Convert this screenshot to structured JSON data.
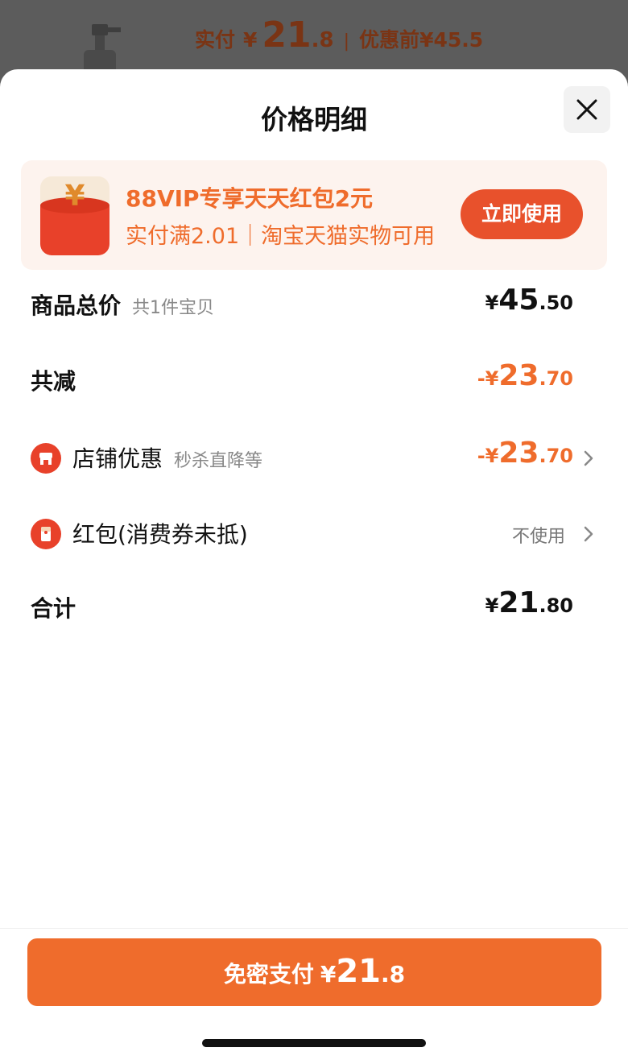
{
  "background": {
    "paid_label": "实付",
    "currency": "¥",
    "paid_int": "21",
    "paid_dec": ".8",
    "separator": "|",
    "original_label": "优惠前",
    "original_price": "¥45.5"
  },
  "sheet": {
    "title": "价格明细"
  },
  "promo": {
    "icon_char": "¥",
    "title": "88VIP专享天天红包2元",
    "subtitle": "实付满2.01｜淘宝天猫实物可用",
    "button_label": "立即使用"
  },
  "rows": {
    "total": {
      "label": "商品总价",
      "hint": "共1件宝贝",
      "sym": "¥",
      "int": "45",
      "dec": ".50"
    },
    "reduction": {
      "label": "共减",
      "sym": "-¥",
      "int": "23",
      "dec": ".70"
    },
    "store": {
      "label": "店铺优惠",
      "hint": "秒杀直降等",
      "sym": "-¥",
      "int": "23",
      "dec": ".70"
    },
    "redpacket": {
      "label": "红包(消费券未抵)",
      "value": "不使用"
    },
    "sum": {
      "label": "合计",
      "sym": "¥",
      "int": "21",
      "dec": ".80"
    }
  },
  "pay": {
    "label": "免密支付",
    "sym": "¥",
    "int": "21",
    "dec": ".8"
  },
  "colors": {
    "accent": "#ef6c2c",
    "promo_bg": "#fdf3ee",
    "button": "#e8512c"
  }
}
